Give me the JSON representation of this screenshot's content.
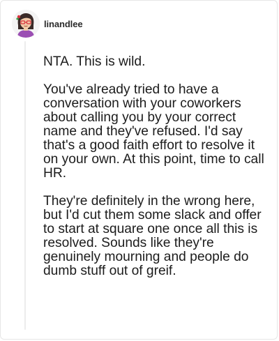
{
  "comment": {
    "username": "linandlee",
    "avatar_icon": "cartoon-girl-glasses-avatar",
    "paragraphs": [
      "NTA. This is wild.",
      "You've already tried to have a conversation with your coworkers about calling you by your correct name and they've refused. I'd say that's a good faith effort to resolve it on your own. At this point, time to call HR.",
      "They're definitely in the wrong here, but I'd cut them some slack and offer to start at square one once all this is resolved. Sounds like they're genuinely mourning and people do dumb stuff out of greif."
    ]
  },
  "colors": {
    "avatar_hair": "#3a2a28",
    "avatar_shirt": "#9b4fb3",
    "avatar_skin": "#f1c9a8",
    "text": "#1c1c1c",
    "thread_line": "#ececec"
  }
}
